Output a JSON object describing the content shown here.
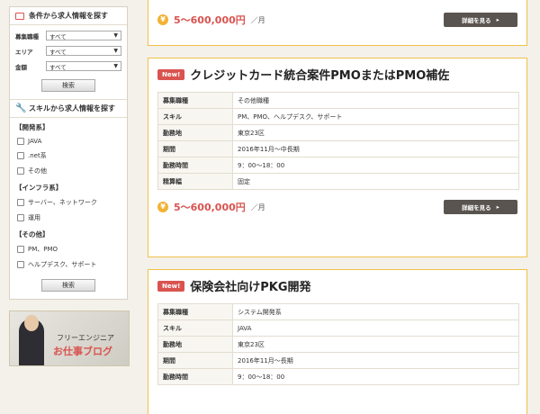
{
  "sidebar": {
    "search_title": "条件から求人情報を探す",
    "rows": [
      {
        "label": "募集職種",
        "value": "すべて"
      },
      {
        "label": "エリア",
        "value": "すべて"
      },
      {
        "label": "金額",
        "value": "すべて"
      }
    ],
    "search_button": "検索",
    "skill_title": "スキルから求人情報を探す",
    "groups": [
      {
        "title": "【開発系】",
        "items": [
          "JAVA",
          ".net系",
          "その他"
        ]
      },
      {
        "title": "【インフラ系】",
        "items": [
          "サーバー、ネットワーク",
          "運用"
        ]
      },
      {
        "title": "【その他】",
        "items": [
          "PM、PMO",
          "ヘルプデスク、サポート"
        ]
      }
    ],
    "search_button2": "検索",
    "banner": {
      "line1": "フリーエンジニア",
      "line2": "お仕事ブログ"
    }
  },
  "jobs": [
    {
      "price": "5〜600,000円",
      "unit": "／月",
      "detail": "詳細を見る"
    },
    {
      "badge": "New!",
      "title": "クレジットカード統合案件PMOまたはPMO補佐",
      "rows": [
        {
          "k": "募集職種",
          "v": "その他職種"
        },
        {
          "k": "スキル",
          "v": "PM、PMO、ヘルプデスク、サポート"
        },
        {
          "k": "勤務地",
          "v": "東京23区"
        },
        {
          "k": "期間",
          "v": "2016年11月〜中長期"
        },
        {
          "k": "勤務時間",
          "v": "9：00〜18：00"
        },
        {
          "k": "精算幅",
          "v": "固定"
        }
      ],
      "price": "5〜600,000円",
      "unit": "／月",
      "detail": "詳細を見る"
    },
    {
      "badge": "New!",
      "title": "保険会社向けPKG開発",
      "rows": [
        {
          "k": "募集職種",
          "v": "システム開発系"
        },
        {
          "k": "スキル",
          "v": "JAVA"
        },
        {
          "k": "勤務地",
          "v": "東京23区"
        },
        {
          "k": "期間",
          "v": "2016年11月〜長期"
        },
        {
          "k": "勤務時間",
          "v": "9：00〜18：00"
        }
      ]
    }
  ]
}
